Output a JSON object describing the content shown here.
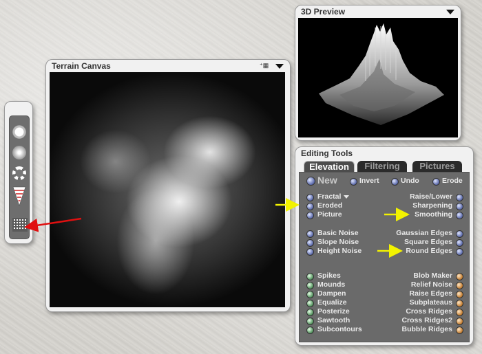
{
  "preview": {
    "title": "3D Preview"
  },
  "terrain": {
    "title": "Terrain Canvas"
  },
  "toolbar": {
    "tools": [
      {
        "icon": "brush-hard-icon"
      },
      {
        "icon": "brush-soft-icon"
      },
      {
        "icon": "brush-spray-icon"
      },
      {
        "icon": "brush-strength-icon"
      },
      {
        "icon": "grid-tool-icon"
      }
    ]
  },
  "editing": {
    "title": "Editing Tools",
    "tabs": [
      "Elevation",
      "Filtering",
      "Pictures"
    ],
    "top_row": {
      "new": "New",
      "invert": "Invert",
      "undo": "Undo",
      "erode": "Erode"
    },
    "group1_left": [
      "Fractal",
      "Eroded",
      "Picture"
    ],
    "group1_right": [
      "Raise/Lower",
      "Sharpening",
      "Smoothing"
    ],
    "group2_left": [
      "Basic Noise",
      "Slope Noise",
      "Height Noise"
    ],
    "group2_right": [
      "Gaussian Edges",
      "Square Edges",
      "Round Edges"
    ],
    "group3_left": [
      "Spikes",
      "Mounds",
      "Dampen",
      "Equalize",
      "Posterize",
      "Sawtooth",
      "Subcontours"
    ],
    "group3_right": [
      "Blob Maker",
      "Relief Noise",
      "Raise Edges",
      "Subplateaus",
      "Cross Ridges",
      "Cross Ridges2",
      "Bubble Ridges"
    ]
  },
  "annotations": {
    "arrow_colors": {
      "red": "#e01010",
      "yellow": "#f2f200"
    }
  }
}
